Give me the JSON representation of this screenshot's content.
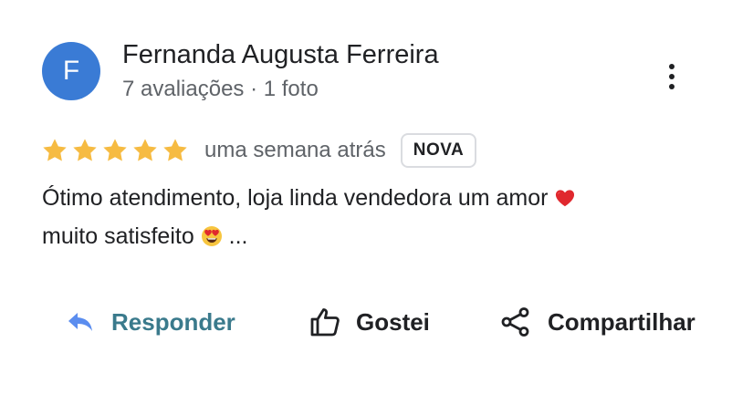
{
  "reviewer": {
    "initial": "F",
    "name": "Fernanda Augusta Ferreira",
    "meta": "7 avaliações · 1 foto",
    "avatar_color": "#3a7bd5"
  },
  "review": {
    "rating": 5,
    "max_rating": 5,
    "date": "uma semana atrás",
    "badge": "NOVA",
    "line1": "Ótimo atendimento, loja linda vendedora um amor ",
    "line2": "muito satisfeito ",
    "ellipsis": "...",
    "star_color": "#f6bb42"
  },
  "actions": {
    "reply_label": "Responder",
    "like_label": "Gostei",
    "share_label": "Compartilhar",
    "reply_color": "#3a7a8c"
  }
}
